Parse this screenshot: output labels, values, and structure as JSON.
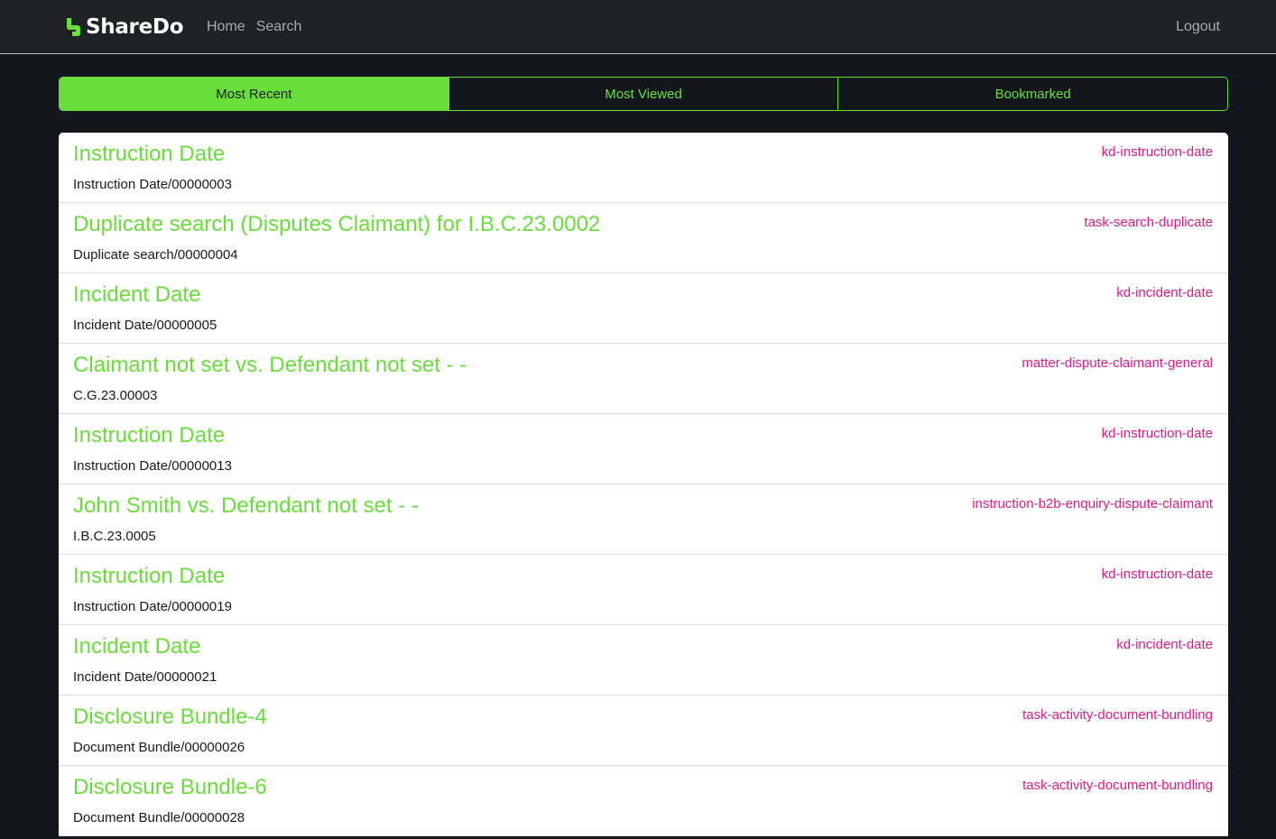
{
  "navbar": {
    "brand": "ShareDo",
    "links": [
      "Home",
      "Search"
    ],
    "logout": "Logout"
  },
  "tabs": [
    {
      "label": "Most Recent",
      "active": true
    },
    {
      "label": "Most Viewed",
      "active": false
    },
    {
      "label": "Bookmarked",
      "active": false
    }
  ],
  "items": [
    {
      "title": "Instruction Date",
      "ref": "Instruction Date/00000003",
      "tag": "kd-instruction-date"
    },
    {
      "title": "Duplicate search (Disputes Claimant) for I.B.C.23.0002",
      "ref": "Duplicate search/00000004",
      "tag": "task-search-duplicate"
    },
    {
      "title": "Incident Date",
      "ref": "Incident Date/00000005",
      "tag": "kd-incident-date"
    },
    {
      "title": "Claimant not set vs. Defendant not set - -",
      "ref": "C.G.23.00003",
      "tag": "matter-dispute-claimant-general"
    },
    {
      "title": "Instruction Date",
      "ref": "Instruction Date/00000013",
      "tag": "kd-instruction-date"
    },
    {
      "title": "John Smith vs. Defendant not set - -",
      "ref": "I.B.C.23.0005",
      "tag": "instruction-b2b-enquiry-dispute-claimant"
    },
    {
      "title": "Instruction Date",
      "ref": "Instruction Date/00000019",
      "tag": "kd-instruction-date"
    },
    {
      "title": "Incident Date",
      "ref": "Incident Date/00000021",
      "tag": "kd-incident-date"
    },
    {
      "title": "Disclosure Bundle-4",
      "ref": "Document Bundle/00000026",
      "tag": "task-activity-document-bundling"
    },
    {
      "title": "Disclosure Bundle-6",
      "ref": "Document Bundle/00000028",
      "tag": "task-activity-document-bundling"
    }
  ],
  "colors": {
    "accent": "#69de3a",
    "tag": "#e01a8c",
    "navbar": "#1f2124",
    "background": "#14161d"
  }
}
